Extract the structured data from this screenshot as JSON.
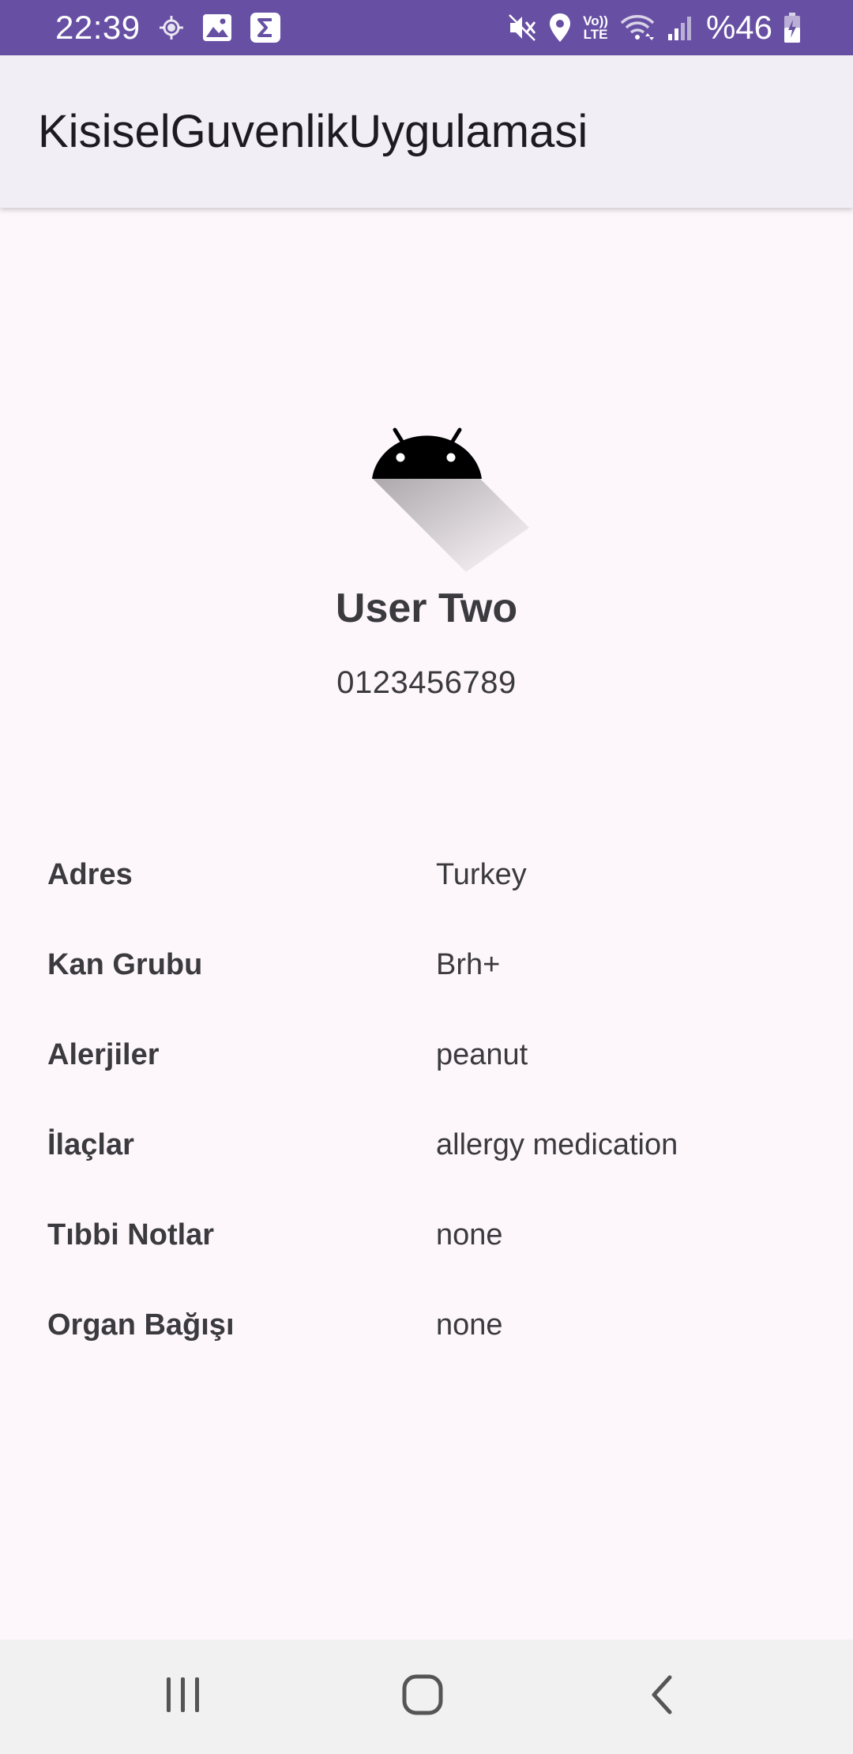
{
  "status_bar": {
    "time": "22:39",
    "battery": "%46",
    "left_icons": [
      "location-target-icon",
      "gallery-icon",
      "sigma-icon"
    ],
    "right_icons": [
      "mute-icon",
      "location-pin-icon",
      "volte-icon",
      "wifi-icon",
      "signal-icon",
      "battery-charging-icon"
    ],
    "volte_line1": "Vo))",
    "volte_line2": "LTE"
  },
  "app_bar": {
    "title": "KisiselGuvenlikUygulamasi"
  },
  "profile": {
    "avatar_icon": "android-icon",
    "name": "User Two",
    "phone": "0123456789"
  },
  "info": {
    "rows": [
      {
        "label": "Adres",
        "value": "Turkey"
      },
      {
        "label": "Kan Grubu",
        "value": "Brh+"
      },
      {
        "label": "Alerjiler",
        "value": "peanut"
      },
      {
        "label": "İlaçlar",
        "value": "allergy medication"
      },
      {
        "label": "Tıbbi Notlar",
        "value": "none"
      },
      {
        "label": "Organ Bağışı",
        "value": "none"
      }
    ]
  },
  "nav_bar": {
    "buttons": [
      "recents-icon",
      "home-icon",
      "back-icon"
    ]
  },
  "colors": {
    "status_bar": "#6750a4",
    "app_bar": "#f2eef6",
    "background": "#fdf7fc",
    "text": "#3b3a3e",
    "nav_bar": "#f1f1f1"
  }
}
